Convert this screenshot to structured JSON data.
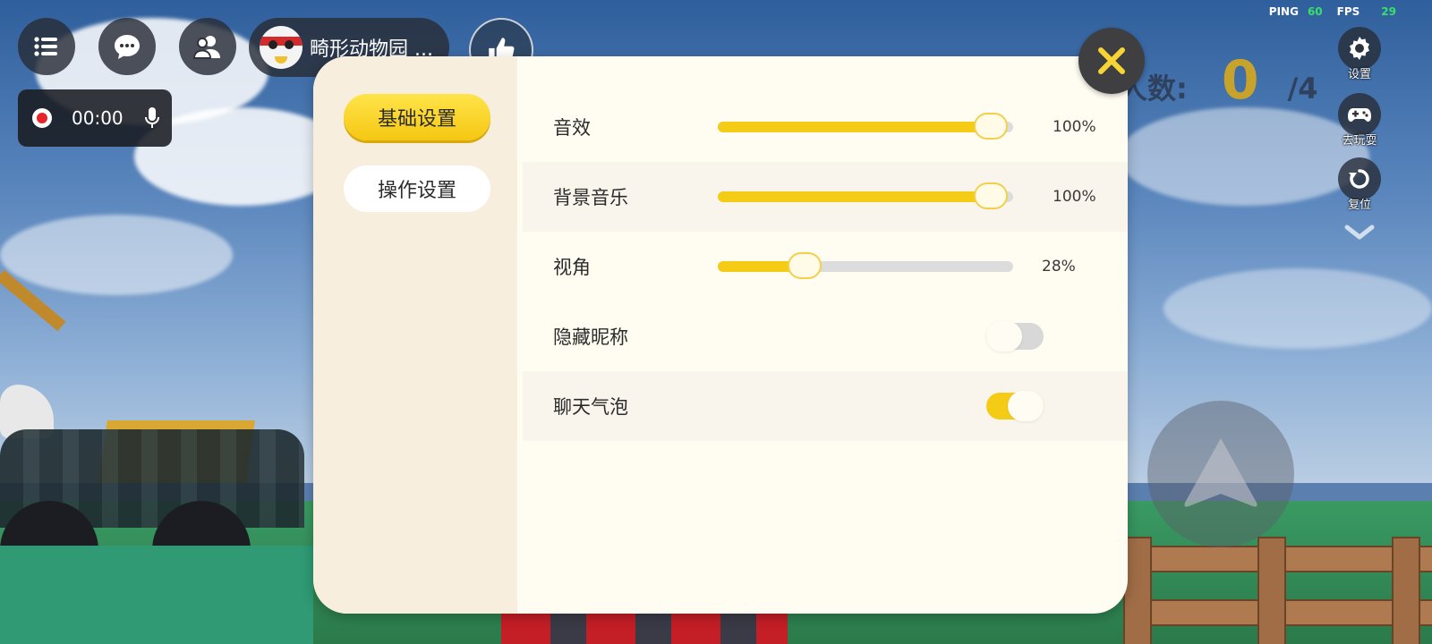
{
  "hud": {
    "menu_icon": "list-icon",
    "chat_icon": "chat-bubble-icon",
    "friends_icon": "friends-icon",
    "map_name": "畸形动物园 ...",
    "like_icon": "thumbs-up-icon",
    "record": {
      "time": "00:00",
      "mic_icon": "microphone-icon"
    },
    "stats": {
      "ping_label": "PING",
      "ping_value": "60",
      "fps_label": "FPS",
      "fps_value": "29"
    },
    "player_count": {
      "label": "人数:",
      "current": "0",
      "max": "/4"
    },
    "side_tools": [
      {
        "label": "设置",
        "icon": "gear-icon"
      },
      {
        "label": "去玩耍",
        "icon": "gamepad-icon"
      },
      {
        "label": "复位",
        "icon": "reset-icon"
      }
    ],
    "jump_icon": "arrow-up-icon"
  },
  "settings": {
    "tabs": [
      {
        "label": "基础设置",
        "active": true
      },
      {
        "label": "操作设置",
        "active": false
      }
    ],
    "sliders": [
      {
        "label": "音效",
        "value": "100%",
        "fraction": 1.0
      },
      {
        "label": "背景音乐",
        "value": "100%",
        "fraction": 1.0
      },
      {
        "label": "视角",
        "value": "28%",
        "fraction": 0.28
      }
    ],
    "toggles": [
      {
        "label": "隐藏昵称",
        "on": false
      },
      {
        "label": "聊天气泡",
        "on": true
      }
    ],
    "close_icon": "close-icon"
  },
  "colors": {
    "accent": "#f5cc15",
    "panel": "#fffcf2",
    "sidebar": "#f7eedd"
  }
}
